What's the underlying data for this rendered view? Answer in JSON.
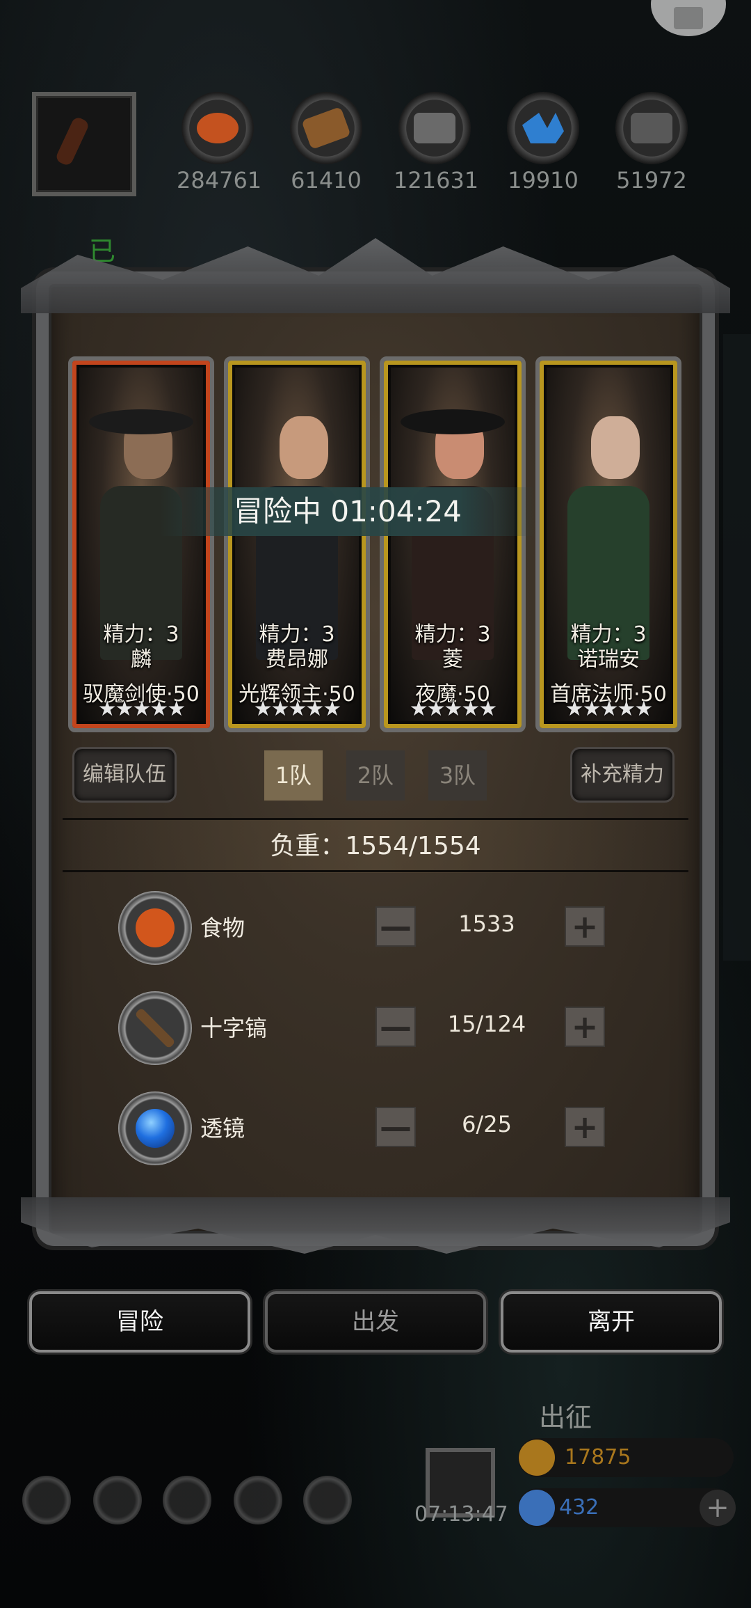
{
  "resources": [
    {
      "icon": "food-icon",
      "value": "284761",
      "color": "#c4521f"
    },
    {
      "icon": "wood-icon",
      "value": "61410",
      "color": "#8a5a2b"
    },
    {
      "icon": "iron-icon",
      "value": "121631",
      "color": "#6a6a6a"
    },
    {
      "icon": "crystal-icon",
      "value": "19910",
      "color": "#2f7fd0"
    },
    {
      "icon": "stone-icon",
      "value": "51972",
      "color": "#585858"
    }
  ],
  "background": {
    "partial_text": "已"
  },
  "panel": {
    "status": "冒险中 01:04:24",
    "heroes": [
      {
        "stamina": "精力：3",
        "name": "麟",
        "title": "驭魔剑使·50",
        "stars": "★★★★★",
        "frame": "red"
      },
      {
        "stamina": "精力：3",
        "name": "费昂娜",
        "title": "光辉领主·50",
        "stars": "★★★★★",
        "frame": "gold"
      },
      {
        "stamina": "精力：3",
        "name": "菱",
        "title": "夜魔·50",
        "stars": "★★★★★",
        "frame": "gold"
      },
      {
        "stamina": "精力：3",
        "name": "诺瑞安",
        "title": "首席法师·50",
        "stars": "★★★★★",
        "frame": "gold"
      }
    ],
    "edit_team": "编辑队伍",
    "teams": [
      "1队",
      "2队",
      "3队"
    ],
    "active_team": "1队",
    "refill_stamina": "补充精力",
    "weight": "负重：1554/1554",
    "supplies": [
      {
        "name": "食物",
        "count": "1533",
        "icon": "food-icon",
        "color": "#d2561c"
      },
      {
        "name": "十字镐",
        "count": "15/124",
        "icon": "pickaxe-icon",
        "color": "#6b4a2a"
      },
      {
        "name": "透镜",
        "count": "6/25",
        "icon": "lens-icon",
        "color": "#1f6fe0"
      }
    ],
    "minus_label": "—",
    "plus_label": "+"
  },
  "actions": {
    "adventure": "冒险",
    "depart": "出发",
    "leave": "离开"
  },
  "hud": {
    "expedition": "出征",
    "timer": "07:13:47",
    "gold": "17875",
    "gems": "432",
    "add": "+",
    "gold_color": "#a9771d",
    "gem_color": "#3a6fb8"
  }
}
